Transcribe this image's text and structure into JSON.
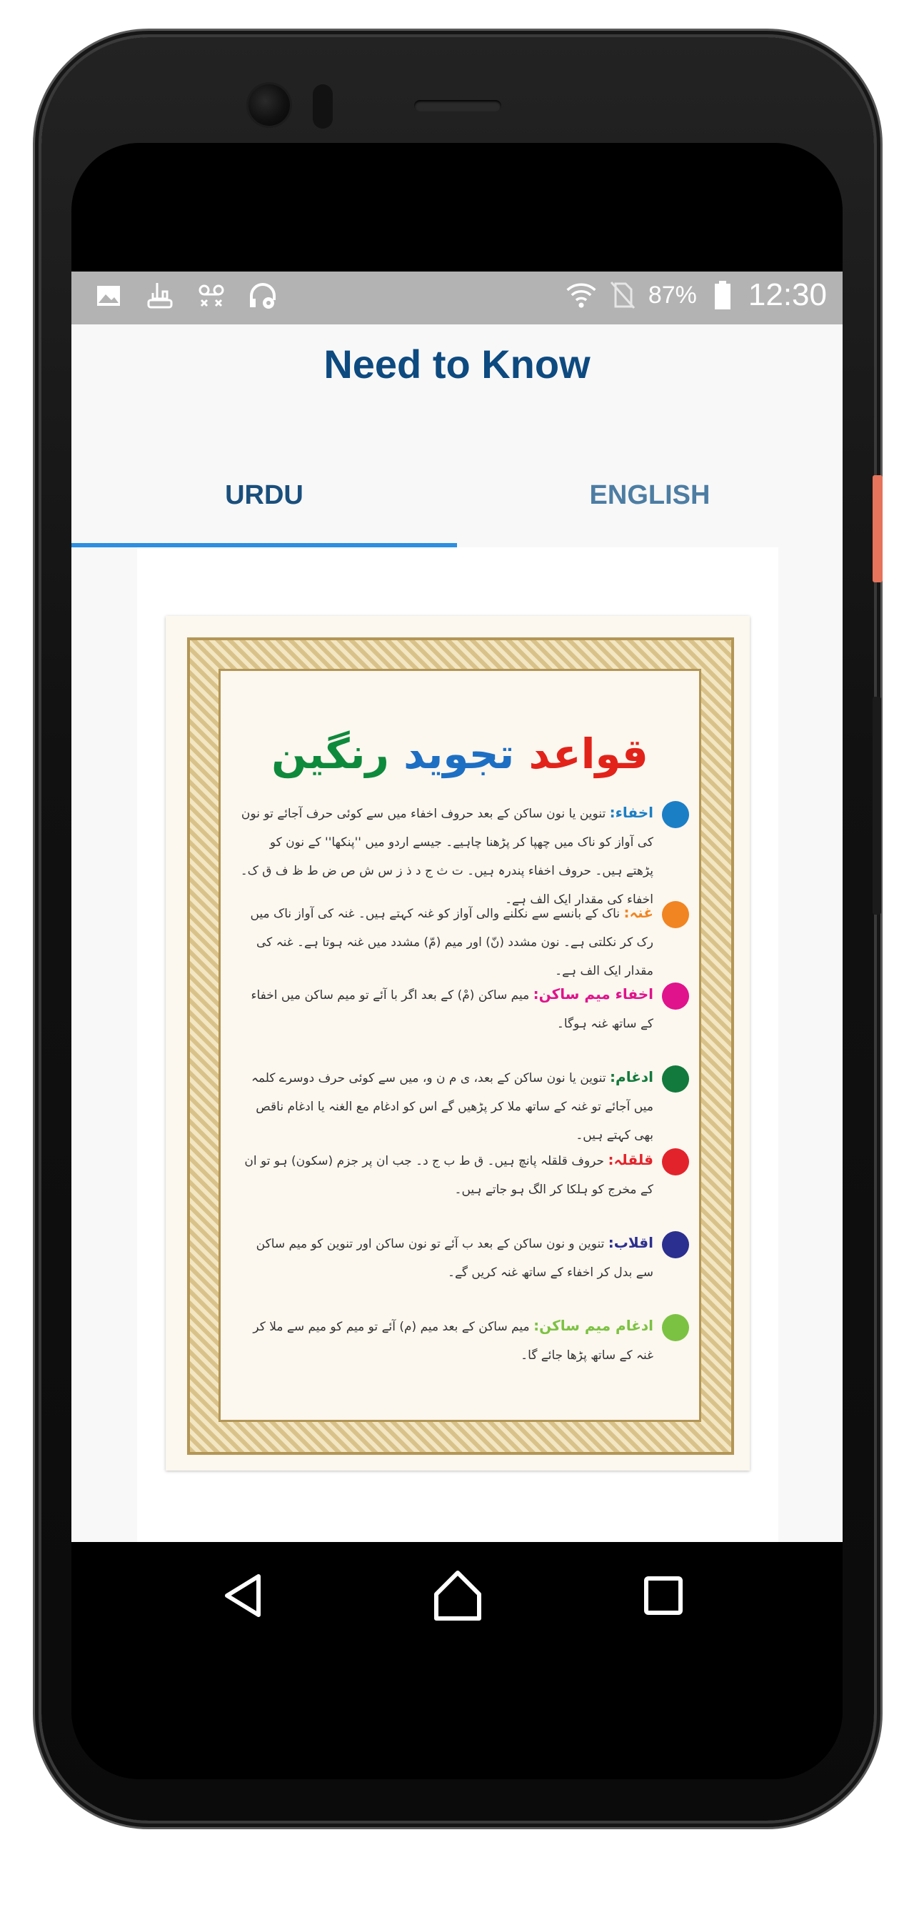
{
  "status_bar": {
    "left_icons": [
      "image-icon",
      "usb-debug-icon",
      "voicemail-icon",
      "headset-settings-icon"
    ],
    "battery_percent": "87%",
    "time": "12:30",
    "icons": [
      "wifi-icon",
      "no-sim-icon",
      "battery-icon"
    ]
  },
  "header": {
    "title": "Need to Know"
  },
  "tabs": [
    {
      "label": "URDU",
      "selected": true
    },
    {
      "label": "ENGLISH",
      "selected": false
    }
  ],
  "poster": {
    "title_parts": [
      "قواعد",
      "تجوید",
      "رنگین"
    ],
    "rules": [
      {
        "term": "اخفاء:",
        "color": "#1b7fc6",
        "text": "تنوین یا نون ساکن کے بعد حروف اخفاء میں سے کوئی حرف آجائے تو نون کی آواز کو ناک میں چھپا کر پڑھنا چاہیے۔ جیسے اردو میں ''پنکھا'' کے نون کو پڑھتے ہیں۔ حروف اخفاء پندرہ ہیں۔ ت ث ج د ذ ز س ش ص ض ط ظ ف ق ک۔ اخفاء کی مقدار ایک الف ہے۔"
      },
      {
        "term": "غنہ:",
        "color": "#f08522",
        "text": "ناک کے بانسے سے نکلنے والی آواز کو غنہ کہتے ہیں۔ غنہ کی آواز ناک میں رک کر نکلتی ہے۔ نون مشدد (نّ) اور میم (مّ) مشدد میں غنہ ہوتا ہے۔ غنہ کی مقدار ایک الف ہے۔"
      },
      {
        "term": "اخفاء میم ساکن:",
        "color": "#e0138c",
        "text": "میم ساکن (مْ) کے بعد اگر با آئے تو میم ساکن میں اخفاء کے ساتھ غنہ ہوگا۔"
      },
      {
        "term": "ادغام:",
        "color": "#127a3c",
        "text": "تنوین یا نون ساکن کے بعد، ی م ن و، میں سے کوئی حرف دوسرے کلمہ میں آجائے تو غنہ کے ساتھ ملا کر پڑھیں گے اس کو ادغام مع الغنہ یا ادغام ناقص بھی کہتے ہیں۔"
      },
      {
        "term": "قلقلہ:",
        "color": "#e3232b",
        "text": "حروف قلقلہ پانچ ہیں۔ ق ط ب ج د۔ جب ان پر جزم (سکون) ہو تو ان کے مخرج کو ہلکا کر الگ ہو جاتے ہیں۔"
      },
      {
        "term": "اقلاب:",
        "color": "#2b2f8f",
        "text": "تنوین و نون ساکن کے بعد ب آئے تو نون ساکن اور تنوین کو میم ساکن سے بدل کر اخفاء کے ساتھ غنہ کریں گے۔"
      },
      {
        "term": "ادغام میم ساکن:",
        "color": "#7cc242",
        "text": "میم ساکن کے بعد میم (م) آئے تو میم کو میم سے ملا کر غنہ کے ساتھ پڑھا جائے گا۔"
      }
    ]
  },
  "nav": {
    "back": "back-icon",
    "home": "home-icon",
    "recents": "recents-icon"
  }
}
